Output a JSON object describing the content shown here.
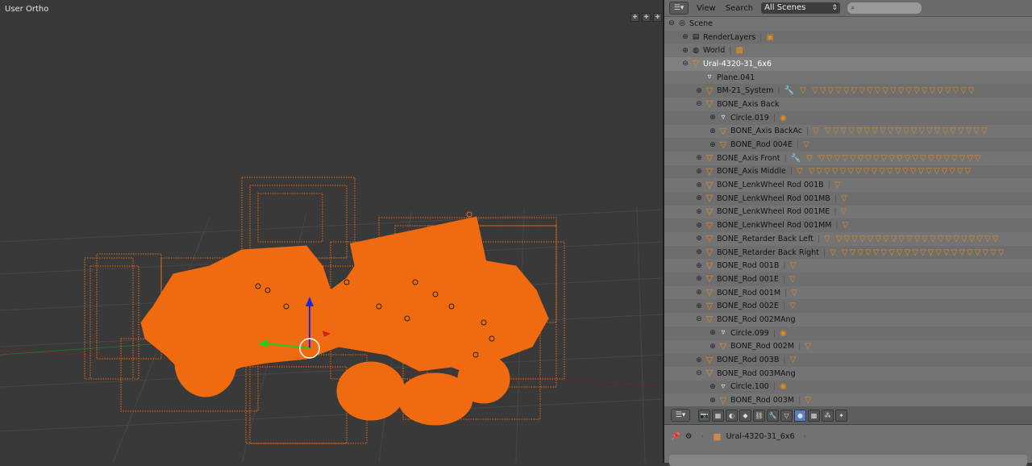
{
  "viewport": {
    "label": "User Ortho"
  },
  "outliner": {
    "menu": [
      "View",
      "Search"
    ],
    "scene_select": "All Scenes",
    "rows": [
      {
        "indent": 0,
        "expander": "⊖",
        "icon": "scene",
        "label": "Scene",
        "extras": ""
      },
      {
        "indent": 1,
        "expander": "⊕",
        "icon": "renderlayers",
        "label": "RenderLayers",
        "extras": "▣"
      },
      {
        "indent": 1,
        "expander": "⊕",
        "icon": "world",
        "label": "World",
        "extras": "▩"
      },
      {
        "indent": 1,
        "expander": "⊖",
        "icon": "armature",
        "label": "Ural-4320-31_6x6",
        "extras": "",
        "selected": true
      },
      {
        "indent": 2,
        "expander": "",
        "icon": "mesh",
        "label": "Plane.041",
        "extras": ""
      },
      {
        "indent": 2,
        "expander": "⊕",
        "icon": "armature",
        "label": "BM-21_System",
        "extras": "🔧 ▽ ▽▽▽▽▽▽▽▽▽▽▽▽▽▽▽▽▽▽▽▽▽"
      },
      {
        "indent": 2,
        "expander": "⊖",
        "icon": "armature",
        "label": "BONE_Axis Back",
        "extras": ""
      },
      {
        "indent": 3,
        "expander": "⊕",
        "icon": "mesh",
        "label": "Circle.019",
        "extras": "◉"
      },
      {
        "indent": 3,
        "expander": "⊕",
        "icon": "armature",
        "label": "BONE_Axis BackAc",
        "extras": "▽ ▽▽▽▽▽▽▽▽▽▽▽▽▽▽▽▽▽▽▽▽▽"
      },
      {
        "indent": 3,
        "expander": "⊕",
        "icon": "armature",
        "label": "BONE_Rod 004E",
        "extras": "▽"
      },
      {
        "indent": 2,
        "expander": "⊕",
        "icon": "armature",
        "label": "BONE_Axis Front",
        "extras": "🔧 ▽ ▽▽▽▽▽▽▽▽▽▽▽▽▽▽▽▽▽▽▽▽▽"
      },
      {
        "indent": 2,
        "expander": "⊕",
        "icon": "armature",
        "label": "BONE_Axis Middle",
        "extras": "▽ ▽▽▽▽▽▽▽▽▽▽▽▽▽▽▽▽▽▽▽▽▽"
      },
      {
        "indent": 2,
        "expander": "⊕",
        "icon": "armature",
        "label": "BONE_LenkWheel Rod 001B",
        "extras": "▽"
      },
      {
        "indent": 2,
        "expander": "⊕",
        "icon": "armature",
        "label": "BONE_LenkWheel Rod 001MB",
        "extras": "▽"
      },
      {
        "indent": 2,
        "expander": "⊕",
        "icon": "armature",
        "label": "BONE_LenkWheel Rod 001ME",
        "extras": "▽"
      },
      {
        "indent": 2,
        "expander": "⊕",
        "icon": "armature",
        "label": "BONE_LenkWheel Rod 001MM",
        "extras": "▽"
      },
      {
        "indent": 2,
        "expander": "⊕",
        "icon": "armature",
        "label": "BONE_Retarder Back Left",
        "extras": "▽ ▽▽▽▽▽▽▽▽▽▽▽▽▽▽▽▽▽▽▽▽▽"
      },
      {
        "indent": 2,
        "expander": "⊕",
        "icon": "armature",
        "label": "BONE_Retarder Back Right",
        "extras": "▽ ▽▽▽▽▽▽▽▽▽▽▽▽▽▽▽▽▽▽▽▽▽"
      },
      {
        "indent": 2,
        "expander": "⊕",
        "icon": "armature",
        "label": "BONE_Rod 001B",
        "extras": "▽"
      },
      {
        "indent": 2,
        "expander": "⊕",
        "icon": "armature",
        "label": "BONE_Rod 001E",
        "extras": "▽"
      },
      {
        "indent": 2,
        "expander": "⊕",
        "icon": "armature",
        "label": "BONE_Rod 001M",
        "extras": "▽"
      },
      {
        "indent": 2,
        "expander": "⊕",
        "icon": "armature",
        "label": "BONE_Rod 002E",
        "extras": "▽"
      },
      {
        "indent": 2,
        "expander": "⊖",
        "icon": "armature",
        "label": "BONE_Rod 002MAng",
        "extras": ""
      },
      {
        "indent": 3,
        "expander": "⊕",
        "icon": "mesh",
        "label": "Circle.099",
        "extras": "◉"
      },
      {
        "indent": 3,
        "expander": "⊕",
        "icon": "armature",
        "label": "BONE_Rod 002M",
        "extras": "▽"
      },
      {
        "indent": 2,
        "expander": "⊕",
        "icon": "armature",
        "label": "BONE_Rod 003B",
        "extras": "▽"
      },
      {
        "indent": 2,
        "expander": "⊖",
        "icon": "armature",
        "label": "BONE_Rod 003MAng",
        "extras": ""
      },
      {
        "indent": 3,
        "expander": "⊕",
        "icon": "mesh",
        "label": "Circle.100",
        "extras": "◉"
      },
      {
        "indent": 3,
        "expander": "⊕",
        "icon": "armature",
        "label": "BONE_Rod 003M",
        "extras": "▽"
      }
    ]
  },
  "properties": {
    "breadcrumb_object": "Ural-4320-31_6x6",
    "tabs": [
      "render-icon",
      "scene-icon",
      "world-icon",
      "object-icon",
      "constraints-icon",
      "modifiers-icon",
      "data-icon",
      "material-icon",
      "texture-icon",
      "particles-icon",
      "physics-icon"
    ],
    "active_tab": 7
  },
  "colors": {
    "wire_orange": "#f06a10",
    "selected_row": "#808080",
    "panel_bg": "#727272",
    "viewport_bg": "#393939"
  }
}
